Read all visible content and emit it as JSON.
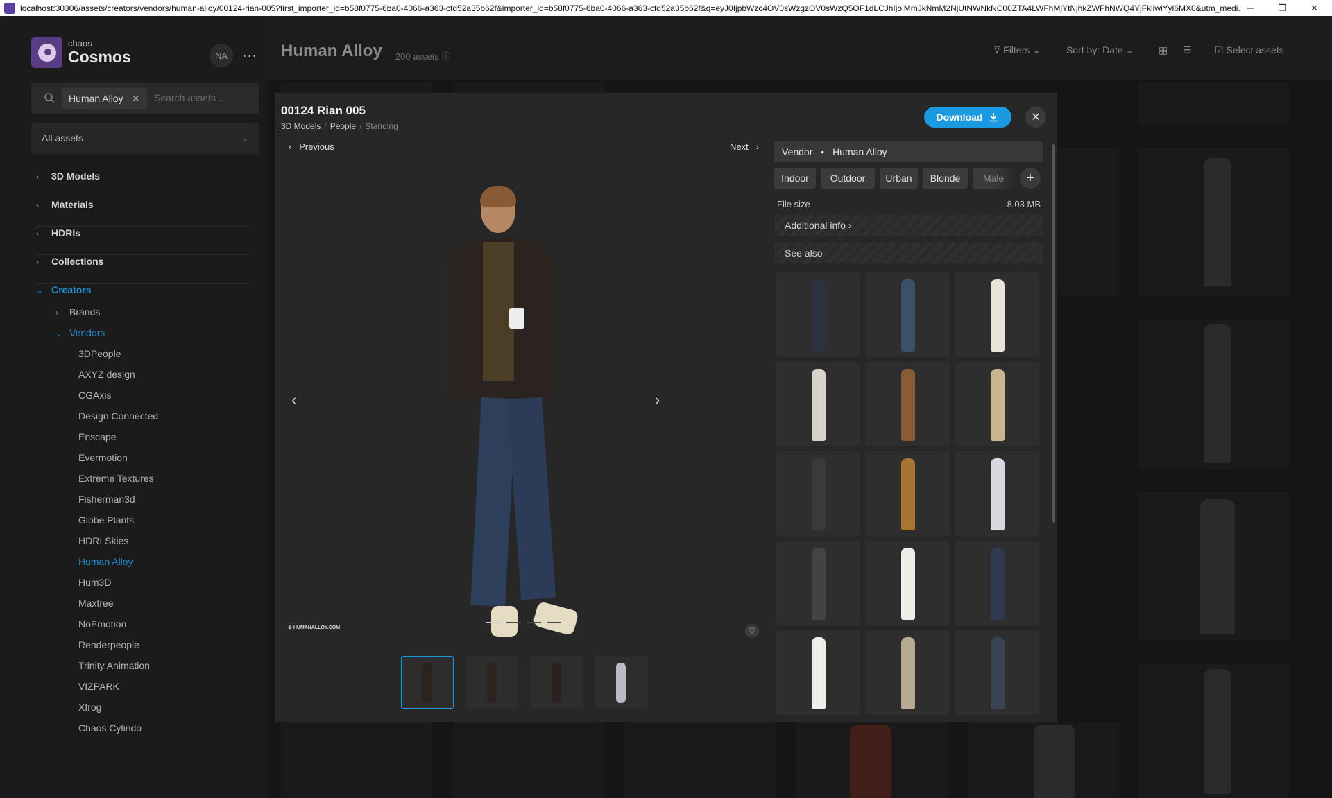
{
  "window": {
    "url": "localhost:30306/assets/creators/vendors/human-alloy/00124-rian-005?first_importer_id=b58f0775-6ba0-4066-a363-cfd52a35b62f&importer_id=b58f0775-6ba0-4066-a363-cfd52a35b62f&q=eyJ0IjpbWzc4OV0sWzgzOV0sWzQ5OF1dLCJhIjoiMmJkNmM2NjUtNWNkNC00ZTA4LWFhMjYtNjhkZWFhNWQ4YjFkliwiYyl6MX0&utm_medi...",
    "controls": {
      "minimize": "─",
      "restore": "❐",
      "close": "✕"
    }
  },
  "brand": {
    "small": "chaos",
    "big": "Cosmos",
    "avatar": "NA",
    "more": "···"
  },
  "search": {
    "chip": "Human Alloy",
    "placeholder": "Search assets ..."
  },
  "filter_select": {
    "label": "All assets"
  },
  "nav": {
    "models": "3D Models",
    "materials": "Materials",
    "hdris": "HDRIs",
    "collections": "Collections",
    "creators": "Creators",
    "brands": "Brands",
    "vendors": "Vendors",
    "vendor_list": [
      "3DPeople",
      "AXYZ design",
      "CGAxis",
      "Design Connected",
      "Enscape",
      "Evermotion",
      "Extreme Textures",
      "Fisherman3d",
      "Globe Plants",
      "HDRI Skies",
      "Human Alloy",
      "Hum3D",
      "Maxtree",
      "NoEmotion",
      "Renderpeople",
      "Trinity Animation",
      "VIZPARK",
      "Xfrog",
      "Chaos Cylindo"
    ]
  },
  "header": {
    "title": "Human Alloy",
    "count": "200 assets",
    "filters": "Filters",
    "sort": "Sort by: Date",
    "select": "Select assets"
  },
  "modal": {
    "title": "00124 Rian 005",
    "breadcrumb": [
      "3D Models",
      "People",
      "Standing"
    ],
    "download": "Download",
    "prev": "Previous",
    "next": "Next",
    "watermark": "HUMANALLOY.COM",
    "vendor_label": "Vendor",
    "vendor_name": "Human Alloy",
    "tags": [
      "Indoor",
      "Outdoor",
      "Urban",
      "Blonde",
      "Male"
    ],
    "file_size_label": "File size",
    "file_size_value": "8.03 MB",
    "additional_info": "Additional info",
    "see_also": "See also"
  },
  "colors": {
    "accent": "#1a9ae0",
    "nav_active": "#1f8bc9",
    "brand_purple": "#5b3d86"
  }
}
